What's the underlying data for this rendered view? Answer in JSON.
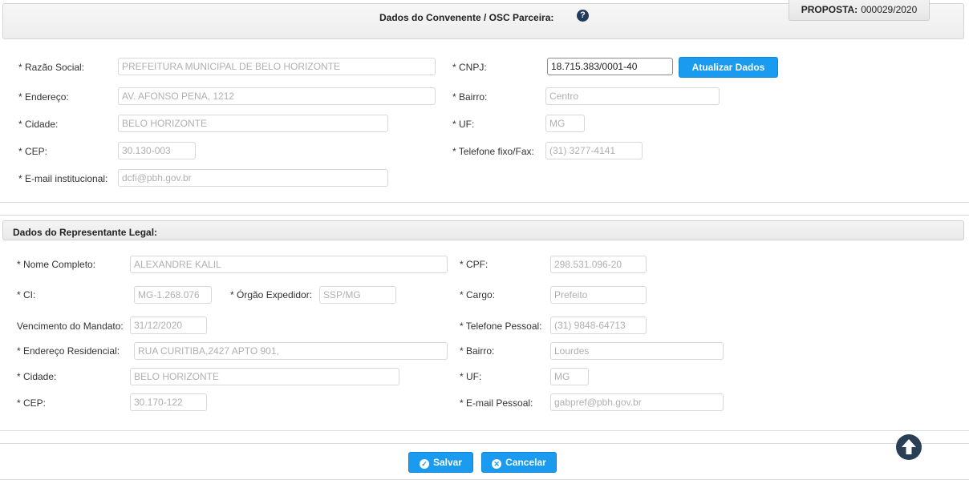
{
  "header": {
    "title": "Dados do Convenente / OSC Parceira:",
    "proposal_label": "PROPOSTA:",
    "proposal_value": "000029/2020"
  },
  "convenente": {
    "razao_social_label": "* Razão Social:",
    "razao_social_value": "PREFEITURA MUNICIPAL DE BELO HORIZONTE",
    "cnpj_label": "* CNPJ:",
    "cnpj_value": "18.715.383/0001-40",
    "update_button": "Atualizar Dados",
    "endereco_label": "* Endereço:",
    "endereco_value": "AV. AFONSO PENA, 1212",
    "bairro_label": "* Bairro:",
    "bairro_value": "Centro",
    "cidade_label": "* Cidade:",
    "cidade_value": "BELO HORIZONTE",
    "uf_label": "* UF:",
    "uf_value": "MG",
    "cep_label": "* CEP:",
    "cep_value": "30.130-003",
    "telefone_label": "* Telefone fixo/Fax:",
    "telefone_value": "(31) 3277-4141",
    "email_label": "* E-mail institucional:",
    "email_value": "dcfi@pbh.gov.br"
  },
  "representante": {
    "section_title": "Dados do Representante Legal:",
    "nome_label": "* Nome Completo:",
    "nome_value": "ALEXANDRE KALIL",
    "cpf_label": "* CPF:",
    "cpf_value": "298.531.096-20",
    "ci_label": "* CI:",
    "ci_value": "MG-1.268.076",
    "orgao_label": "* Órgão Expedidor:",
    "orgao_value": "SSP/MG",
    "cargo_label": "* Cargo:",
    "cargo_value": "Prefeito",
    "vencimento_label": "Vencimento do Mandato:",
    "vencimento_value": "31/12/2020",
    "telefone_label": "* Telefone Pessoal:",
    "telefone_value": "(31) 9848-64713",
    "endereco_label": "* Endereço Residencial:",
    "endereco_value": "RUA CURITIBA,2427  APTO 901,",
    "bairro_label": "* Bairro:",
    "bairro_value": "Lourdes",
    "cidade_label": "* Cidade:",
    "cidade_value": "BELO HORIZONTE",
    "uf_label": "* UF:",
    "uf_value": "MG",
    "cep_label": "* CEP:",
    "cep_value": "30.170-122",
    "email_label": "* E-mail Pessoal:",
    "email_value": "gabpref@pbh.gov.br"
  },
  "footer": {
    "save_label": "Salvar",
    "cancel_label": "Cancelar"
  },
  "colors": {
    "primary_button": "#1a9bf0",
    "scroll_up_button": "#2a3f55",
    "help_icon": "#1f3a5a"
  },
  "icons": {
    "help": "question-circle-icon",
    "save": "check-circle-icon",
    "cancel": "times-circle-icon",
    "scroll_up": "arrow-up-circle-icon"
  }
}
